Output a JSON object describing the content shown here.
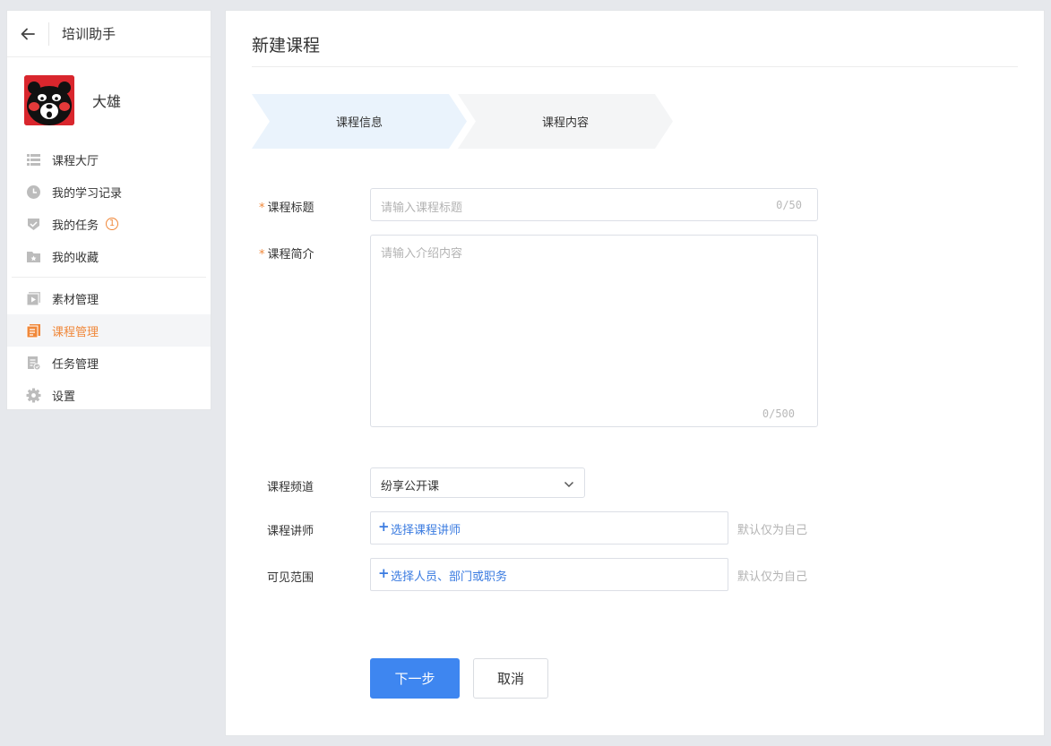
{
  "sidebar": {
    "title": "培训助手",
    "user": {
      "name": "大雄"
    },
    "menu": [
      {
        "label": "课程大厅",
        "icon": "list-icon"
      },
      {
        "label": "我的学习记录",
        "icon": "clock-icon"
      },
      {
        "label": "我的任务",
        "icon": "shield-check-icon",
        "badge": "1"
      },
      {
        "label": "我的收藏",
        "icon": "star-folder-icon"
      }
    ],
    "manage": [
      {
        "label": "素材管理",
        "icon": "play-icon"
      },
      {
        "label": "课程管理",
        "icon": "book-icon",
        "active": true
      },
      {
        "label": "任务管理",
        "icon": "task-doc-icon"
      },
      {
        "label": "设置",
        "icon": "gear-icon"
      }
    ]
  },
  "page": {
    "title": "新建课程"
  },
  "steps": [
    {
      "label": "课程信息",
      "active": true
    },
    {
      "label": "课程内容",
      "active": false
    }
  ],
  "form": {
    "course_title": {
      "label": "课程标题",
      "placeholder": "请输入课程标题",
      "counter": "0/50"
    },
    "course_intro": {
      "label": "课程简介",
      "placeholder": "请输入介绍内容",
      "counter": "0/500"
    },
    "channel": {
      "label": "课程频道",
      "value": "纷享公开课"
    },
    "lecturer": {
      "label": "课程讲师",
      "action": "选择课程讲师",
      "hint": "默认仅为自己"
    },
    "visibility": {
      "label": "可见范围",
      "action": "选择人员、部门或职务",
      "hint": "默认仅为自己"
    }
  },
  "buttons": {
    "next": "下一步",
    "cancel": "取消"
  },
  "colors": {
    "accent": "#f0883a",
    "primary": "#3e86f0",
    "link": "#3a7be0"
  }
}
